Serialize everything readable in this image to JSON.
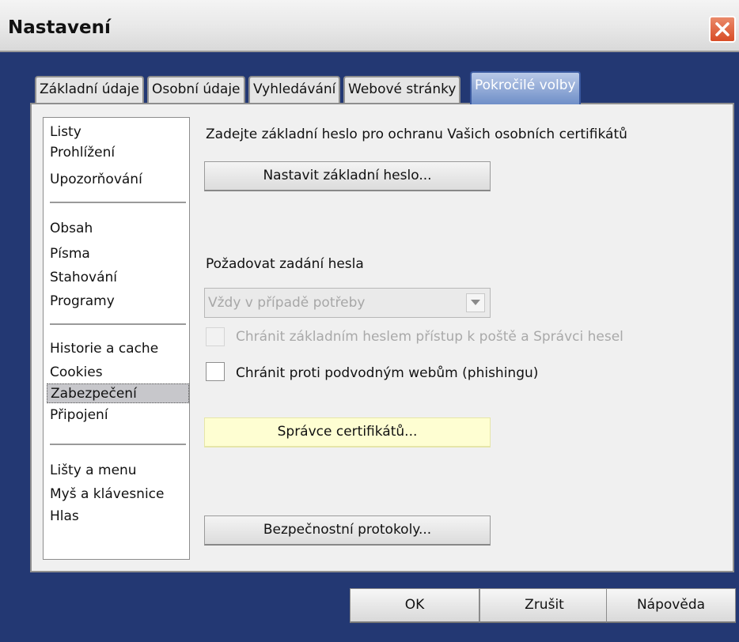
{
  "window": {
    "title": "Nastavení"
  },
  "tabs": [
    {
      "label": "Základní údaje"
    },
    {
      "label": "Osobní údaje"
    },
    {
      "label": "Vyhledávání"
    },
    {
      "label": "Webové stránky"
    },
    {
      "label": "Pokročilé volby",
      "active": true
    }
  ],
  "sidebar": {
    "groups": [
      [
        "Listy",
        "Prohlížení",
        "Upozorňování"
      ],
      [
        "Obsah",
        "Písma",
        "Stahování",
        "Programy"
      ],
      [
        "Historie a cache",
        "Cookies",
        "Zabezpečení",
        "Připojení"
      ],
      [
        "Lišty a menu",
        "Myš a klávesnice",
        "Hlas"
      ]
    ],
    "selected": "Zabezpečení"
  },
  "main": {
    "master_password_text": "Zadejte základní heslo pro ochranu Vašich osobních certifikátů",
    "set_master_password_button": "Nastavit základní heslo...",
    "ask_password_label": "Požadovat zadání hesla",
    "ask_password_select_value": "Vždy v případě potřeby",
    "protect_mail_checkbox_label": "Chránit základním heslem přístup k poště a Správci hesel",
    "phishing_checkbox_label": "Chránit proti podvodným webům (phishingu)",
    "certificate_manager_button": "Správce certifikátů...",
    "security_protocols_button": "Bezpečnostní protokoly..."
  },
  "footer": {
    "ok_label": "OK",
    "cancel_label": "Zrušit",
    "help_label": "Nápověda"
  },
  "colors": {
    "window_background": "#233873",
    "active_tab": "#6f8fc8",
    "close_button": "#d84c26",
    "hover_button": "#fefed2"
  }
}
